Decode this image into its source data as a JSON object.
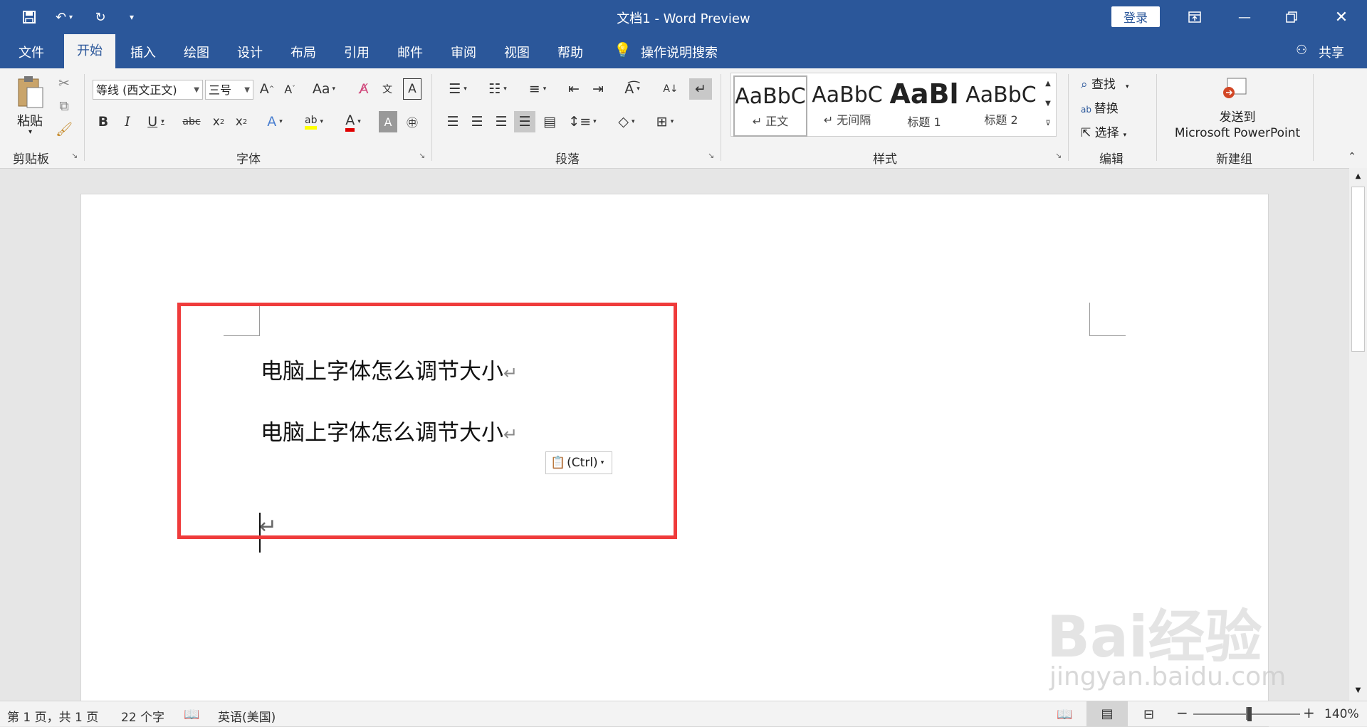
{
  "title_bar": {
    "title": "文档1 - Word Preview",
    "login": "登录"
  },
  "tabs": [
    "文件",
    "开始",
    "插入",
    "绘图",
    "设计",
    "布局",
    "引用",
    "邮件",
    "审阅",
    "视图",
    "帮助"
  ],
  "tell_me": "操作说明搜索",
  "share": "共享",
  "clipboard": {
    "paste": "粘贴",
    "label": "剪贴板"
  },
  "font": {
    "name": "等线 (西文正文)",
    "size": "三号",
    "label": "字体",
    "change_case": "Aa"
  },
  "paragraph": {
    "label": "段落"
  },
  "styles": {
    "label": "样式",
    "items": [
      {
        "preview": "AaBbC",
        "name": "↵ 正文"
      },
      {
        "preview": "AaBbC",
        "name": "↵ 无间隔"
      },
      {
        "preview": "AaBl",
        "name": "标题 1"
      },
      {
        "preview": "AaBbC",
        "name": "标题 2"
      }
    ]
  },
  "editing": {
    "find": "查找",
    "replace": "替换",
    "select": "选择",
    "label": "编辑"
  },
  "new_group": {
    "line1": "发送到",
    "line2": "Microsoft PowerPoint",
    "label": "新建组"
  },
  "document": {
    "lines": [
      "电脑上字体怎么调节大小",
      "电脑上字体怎么调节大小"
    ],
    "paste_options": "(Ctrl)"
  },
  "status": {
    "page": "第 1 页，共 1 页",
    "words": "22 个字",
    "language": "英语(美国)",
    "zoom": "140%"
  },
  "watermark": {
    "brand": "Bai经验",
    "url": "jingyan.baidu.com"
  },
  "colors": {
    "accent": "#2b579a",
    "highlight": "#ef3b3b"
  }
}
